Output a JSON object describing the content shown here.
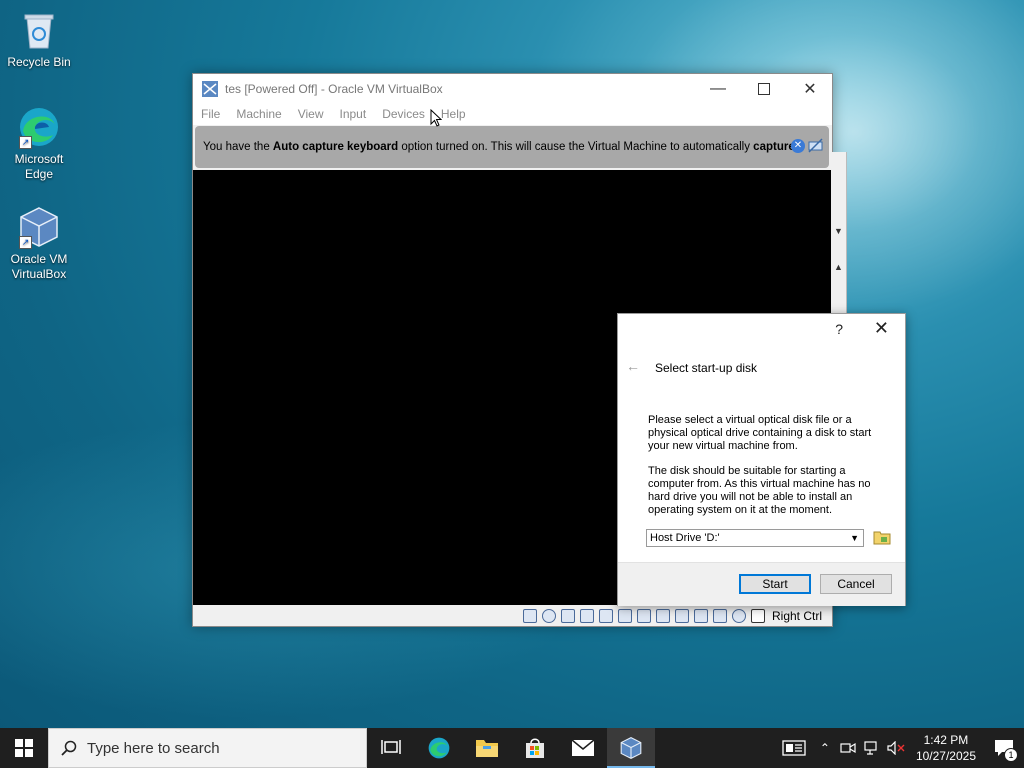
{
  "desktop": {
    "icons": [
      {
        "label": "Recycle Bin"
      },
      {
        "label": "Microsoft Edge"
      },
      {
        "label": "Oracle VM VirtualBox"
      }
    ]
  },
  "vbox": {
    "title": "tes [Powered Off] - Oracle VM VirtualBox",
    "menu": [
      "File",
      "Machine",
      "View",
      "Input",
      "Devices",
      "Help"
    ],
    "notice_pre": "You have the ",
    "notice_bold1": "Auto capture keyboard",
    "notice_mid": " option turned on. This will cause the Virtual Machine to automatically ",
    "notice_bold2": "capture",
    "host_key": "Right Ctrl"
  },
  "dialog": {
    "help": "?",
    "title": "Select start-up disk",
    "para1": "Please select a virtual optical disk file or a physical optical drive containing a disk to start your new virtual machine from.",
    "para2": "The disk should be suitable for starting a computer from. As this virtual machine has no hard drive you will not be able to install an operating system on it at the moment.",
    "selected_drive": "Host Drive 'D:'",
    "start_label": "Start",
    "cancel_label": "Cancel"
  },
  "taskbar": {
    "search_placeholder": "Type here to search",
    "time": "1:42 PM",
    "date": "10/27/2025",
    "notification_count": "1"
  },
  "colors": {
    "accent": "#0078d7",
    "taskbar": "#1f1f1f",
    "notice_bg": "#a8a8a8"
  }
}
